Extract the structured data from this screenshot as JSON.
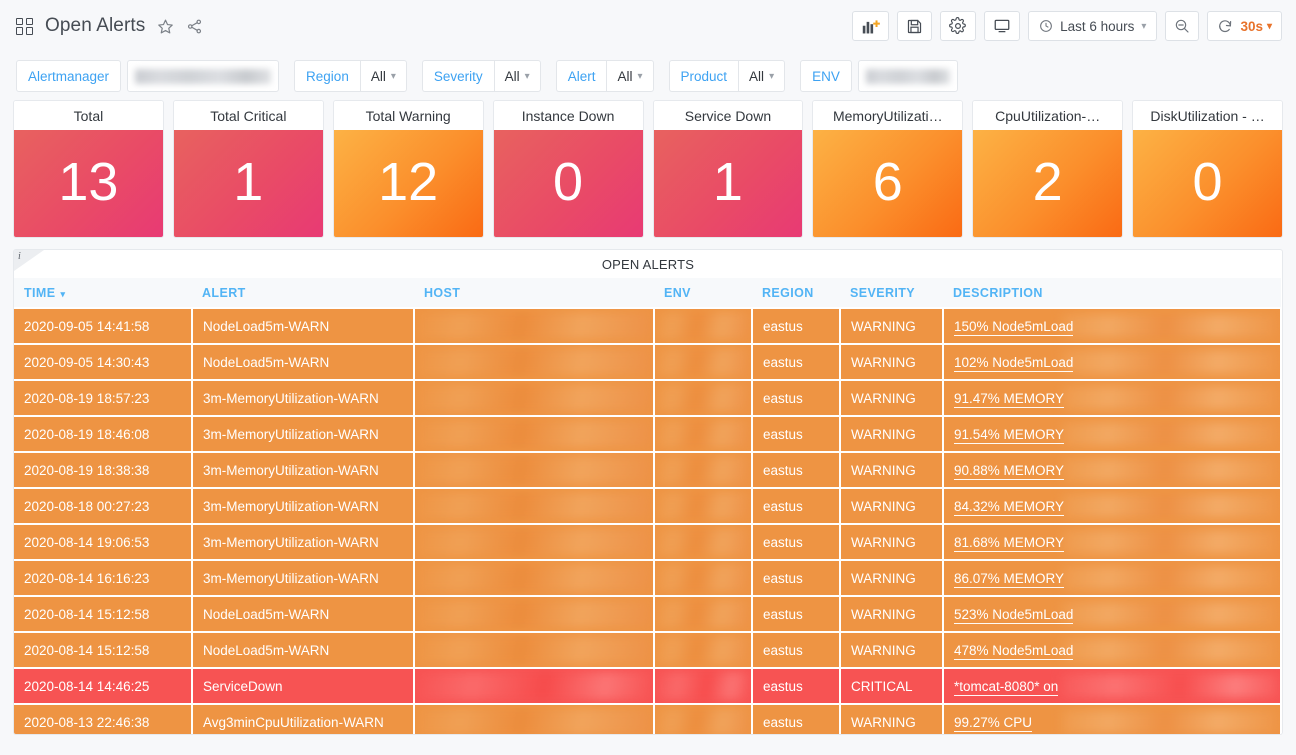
{
  "header": {
    "title": "Open Alerts",
    "dashboard_icon": "dashboard-grid-icon",
    "star_icon": "star-icon",
    "share_icon": "share-icon",
    "add_panel_icon": "add-panel-icon",
    "save_icon": "save-icon",
    "settings_icon": "gear-icon",
    "kiosk_icon": "tv-monitor-icon",
    "clock_icon": "clock-icon",
    "time_range": "Last 6 hours",
    "zoom_out_icon": "zoom-out-icon",
    "refresh_icon": "refresh-icon",
    "refresh_interval": "30s"
  },
  "variables": [
    {
      "label": "Alertmanager",
      "value": "",
      "redacted": true
    },
    {
      "label": "Region",
      "value": "All",
      "redacted": false
    },
    {
      "label": "Severity",
      "value": "All",
      "redacted": false
    },
    {
      "label": "Alert",
      "value": "All",
      "redacted": false
    },
    {
      "label": "Product",
      "value": "All",
      "redacted": false
    },
    {
      "label": "ENV",
      "value": "",
      "redacted": true
    }
  ],
  "stats": [
    {
      "title": "Total",
      "value": "13",
      "color_scheme": "red",
      "accent": "#e8625f"
    },
    {
      "title": "Total Critical",
      "value": "1",
      "color_scheme": "red",
      "accent": "#e8625f"
    },
    {
      "title": "Total Warning",
      "value": "12",
      "color_scheme": "orange",
      "accent": "#fcb245"
    },
    {
      "title": "Instance Down",
      "value": "0",
      "color_scheme": "red",
      "accent": "#e8625f"
    },
    {
      "title": "Service Down",
      "value": "1",
      "color_scheme": "red",
      "accent": "#e8625f"
    },
    {
      "title": "MemoryUtilizati…",
      "value": "6",
      "color_scheme": "orange",
      "accent": "#fcb245"
    },
    {
      "title": "CpuUtilization-…",
      "value": "2",
      "color_scheme": "orange",
      "accent": "#fcb245"
    },
    {
      "title": "DiskUtilization - …",
      "value": "0",
      "color_scheme": "orange",
      "accent": "#fcb245"
    }
  ],
  "table": {
    "panel_title": "OPEN ALERTS",
    "info_icon": "info-icon",
    "columns": [
      "TIME",
      "ALERT",
      "HOST",
      "ENV",
      "REGION",
      "SEVERITY",
      "DESCRIPTION"
    ],
    "sorted_column": "TIME",
    "sort_direction": "desc",
    "rows": [
      {
        "time": "2020-09-05 14:41:58",
        "alert": "NodeLoad5m-WARN",
        "host": "",
        "env": "",
        "region": "eastus",
        "severity": "WARNING",
        "description": "150% Node5mLoad"
      },
      {
        "time": "2020-09-05 14:30:43",
        "alert": "NodeLoad5m-WARN",
        "host": "",
        "env": "",
        "region": "eastus",
        "severity": "WARNING",
        "description": "102% Node5mLoad"
      },
      {
        "time": "2020-08-19 18:57:23",
        "alert": "3m-MemoryUtilization-WARN",
        "host": "",
        "env": "",
        "region": "eastus",
        "severity": "WARNING",
        "description": "91.47% MEMORY"
      },
      {
        "time": "2020-08-19 18:46:08",
        "alert": "3m-MemoryUtilization-WARN",
        "host": "",
        "env": "",
        "region": "eastus",
        "severity": "WARNING",
        "description": "91.54% MEMORY"
      },
      {
        "time": "2020-08-19 18:38:38",
        "alert": "3m-MemoryUtilization-WARN",
        "host": "",
        "env": "",
        "region": "eastus",
        "severity": "WARNING",
        "description": "90.88% MEMORY"
      },
      {
        "time": "2020-08-18 00:27:23",
        "alert": "3m-MemoryUtilization-WARN",
        "host": "",
        "env": "",
        "region": "eastus",
        "severity": "WARNING",
        "description": "84.32% MEMORY"
      },
      {
        "time": "2020-08-14 19:06:53",
        "alert": "3m-MemoryUtilization-WARN",
        "host": "",
        "env": "",
        "region": "eastus",
        "severity": "WARNING",
        "description": "81.68% MEMORY"
      },
      {
        "time": "2020-08-14 16:16:23",
        "alert": "3m-MemoryUtilization-WARN",
        "host": "",
        "env": "",
        "region": "eastus",
        "severity": "WARNING",
        "description": "86.07% MEMORY"
      },
      {
        "time": "2020-08-14 15:12:58",
        "alert": "NodeLoad5m-WARN",
        "host": "",
        "env": "",
        "region": "eastus",
        "severity": "WARNING",
        "description": "523% Node5mLoad"
      },
      {
        "time": "2020-08-14 15:12:58",
        "alert": "NodeLoad5m-WARN",
        "host": "",
        "env": "",
        "region": "eastus",
        "severity": "WARNING",
        "description": "478% Node5mLoad"
      },
      {
        "time": "2020-08-14 14:46:25",
        "alert": "ServiceDown",
        "host": "",
        "env": "",
        "region": "eastus",
        "severity": "CRITICAL",
        "description": "*tomcat-8080* on"
      },
      {
        "time": "2020-08-13 22:46:38",
        "alert": "Avg3minCpuUtilization-WARN",
        "host": "",
        "env": "",
        "region": "eastus",
        "severity": "WARNING",
        "description": "99.27% CPU"
      }
    ]
  },
  "colors": {
    "warning": "#ee9443",
    "critical": "#f75353",
    "link_blue": "#52b4f5",
    "var_label_blue": "#3da2f2",
    "refresh_orange": "#e8732b"
  }
}
